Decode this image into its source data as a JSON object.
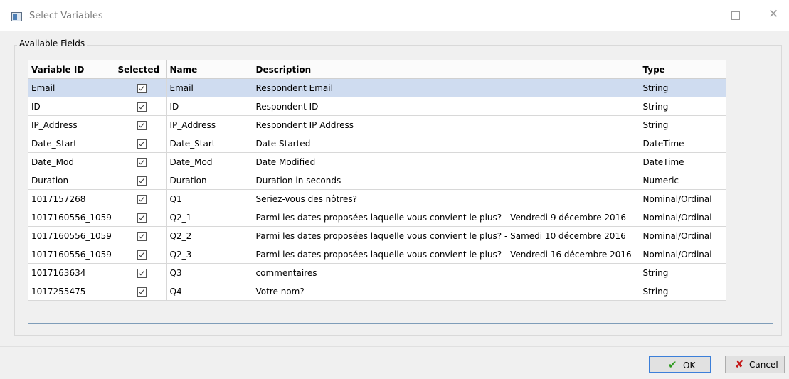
{
  "window": {
    "title": "Select Variables"
  },
  "group": {
    "label": "Available Fields"
  },
  "grid": {
    "columns": [
      "Variable ID",
      "Selected",
      "Name",
      "Description",
      "Type"
    ],
    "rows": [
      {
        "id": "Email",
        "name": "Email",
        "desc": "Respondent Email",
        "type": "String",
        "selected": true
      },
      {
        "id": "ID",
        "name": "ID",
        "desc": "Respondent ID",
        "type": "String",
        "selected": true
      },
      {
        "id": "IP_Address",
        "name": "IP_Address",
        "desc": "Respondent IP Address",
        "type": "String",
        "selected": true
      },
      {
        "id": "Date_Start",
        "name": "Date_Start",
        "desc": "Date Started",
        "type": "DateTime",
        "selected": true
      },
      {
        "id": "Date_Mod",
        "name": "Date_Mod",
        "desc": "Date Modified",
        "type": "DateTime",
        "selected": true
      },
      {
        "id": "Duration",
        "name": "Duration",
        "desc": "Duration in seconds",
        "type": "Numeric",
        "selected": true
      },
      {
        "id": "1017157268",
        "name": "Q1",
        "desc": "Seriez-vous des nôtres?",
        "type": "Nominal/Ordinal",
        "selected": true
      },
      {
        "id": "1017160556_1059",
        "name": "Q2_1",
        "desc": "Parmi les dates proposées laquelle vous convient le plus? - Vendredi 9 décembre 2016",
        "type": "Nominal/Ordinal",
        "selected": true
      },
      {
        "id": "1017160556_1059",
        "name": "Q2_2",
        "desc": "Parmi les dates proposées laquelle vous convient le plus? - Samedi 10 décembre 2016",
        "type": "Nominal/Ordinal",
        "selected": true
      },
      {
        "id": "1017160556_1059",
        "name": "Q2_3",
        "desc": "Parmi les dates proposées laquelle vous convient le plus? - Vendredi 16 décembre 2016",
        "type": "Nominal/Ordinal",
        "selected": true
      },
      {
        "id": "1017163634",
        "name": "Q3",
        "desc": "commentaires",
        "type": "String",
        "selected": true
      },
      {
        "id": "1017255475",
        "name": "Q4",
        "desc": "Votre nom?",
        "type": "String",
        "selected": true
      }
    ],
    "highlighted_row": 0
  },
  "buttons": {
    "ok": "OK",
    "cancel": "Cancel"
  },
  "icons": {
    "app": "window-app-icon",
    "ok": "check-icon",
    "cancel": "x-icon"
  },
  "colors": {
    "selected_row": "#cfdcf0",
    "ok_icon": "#2c9a1c",
    "cancel_icon": "#c41616",
    "focus_border": "#3c7fd9"
  }
}
